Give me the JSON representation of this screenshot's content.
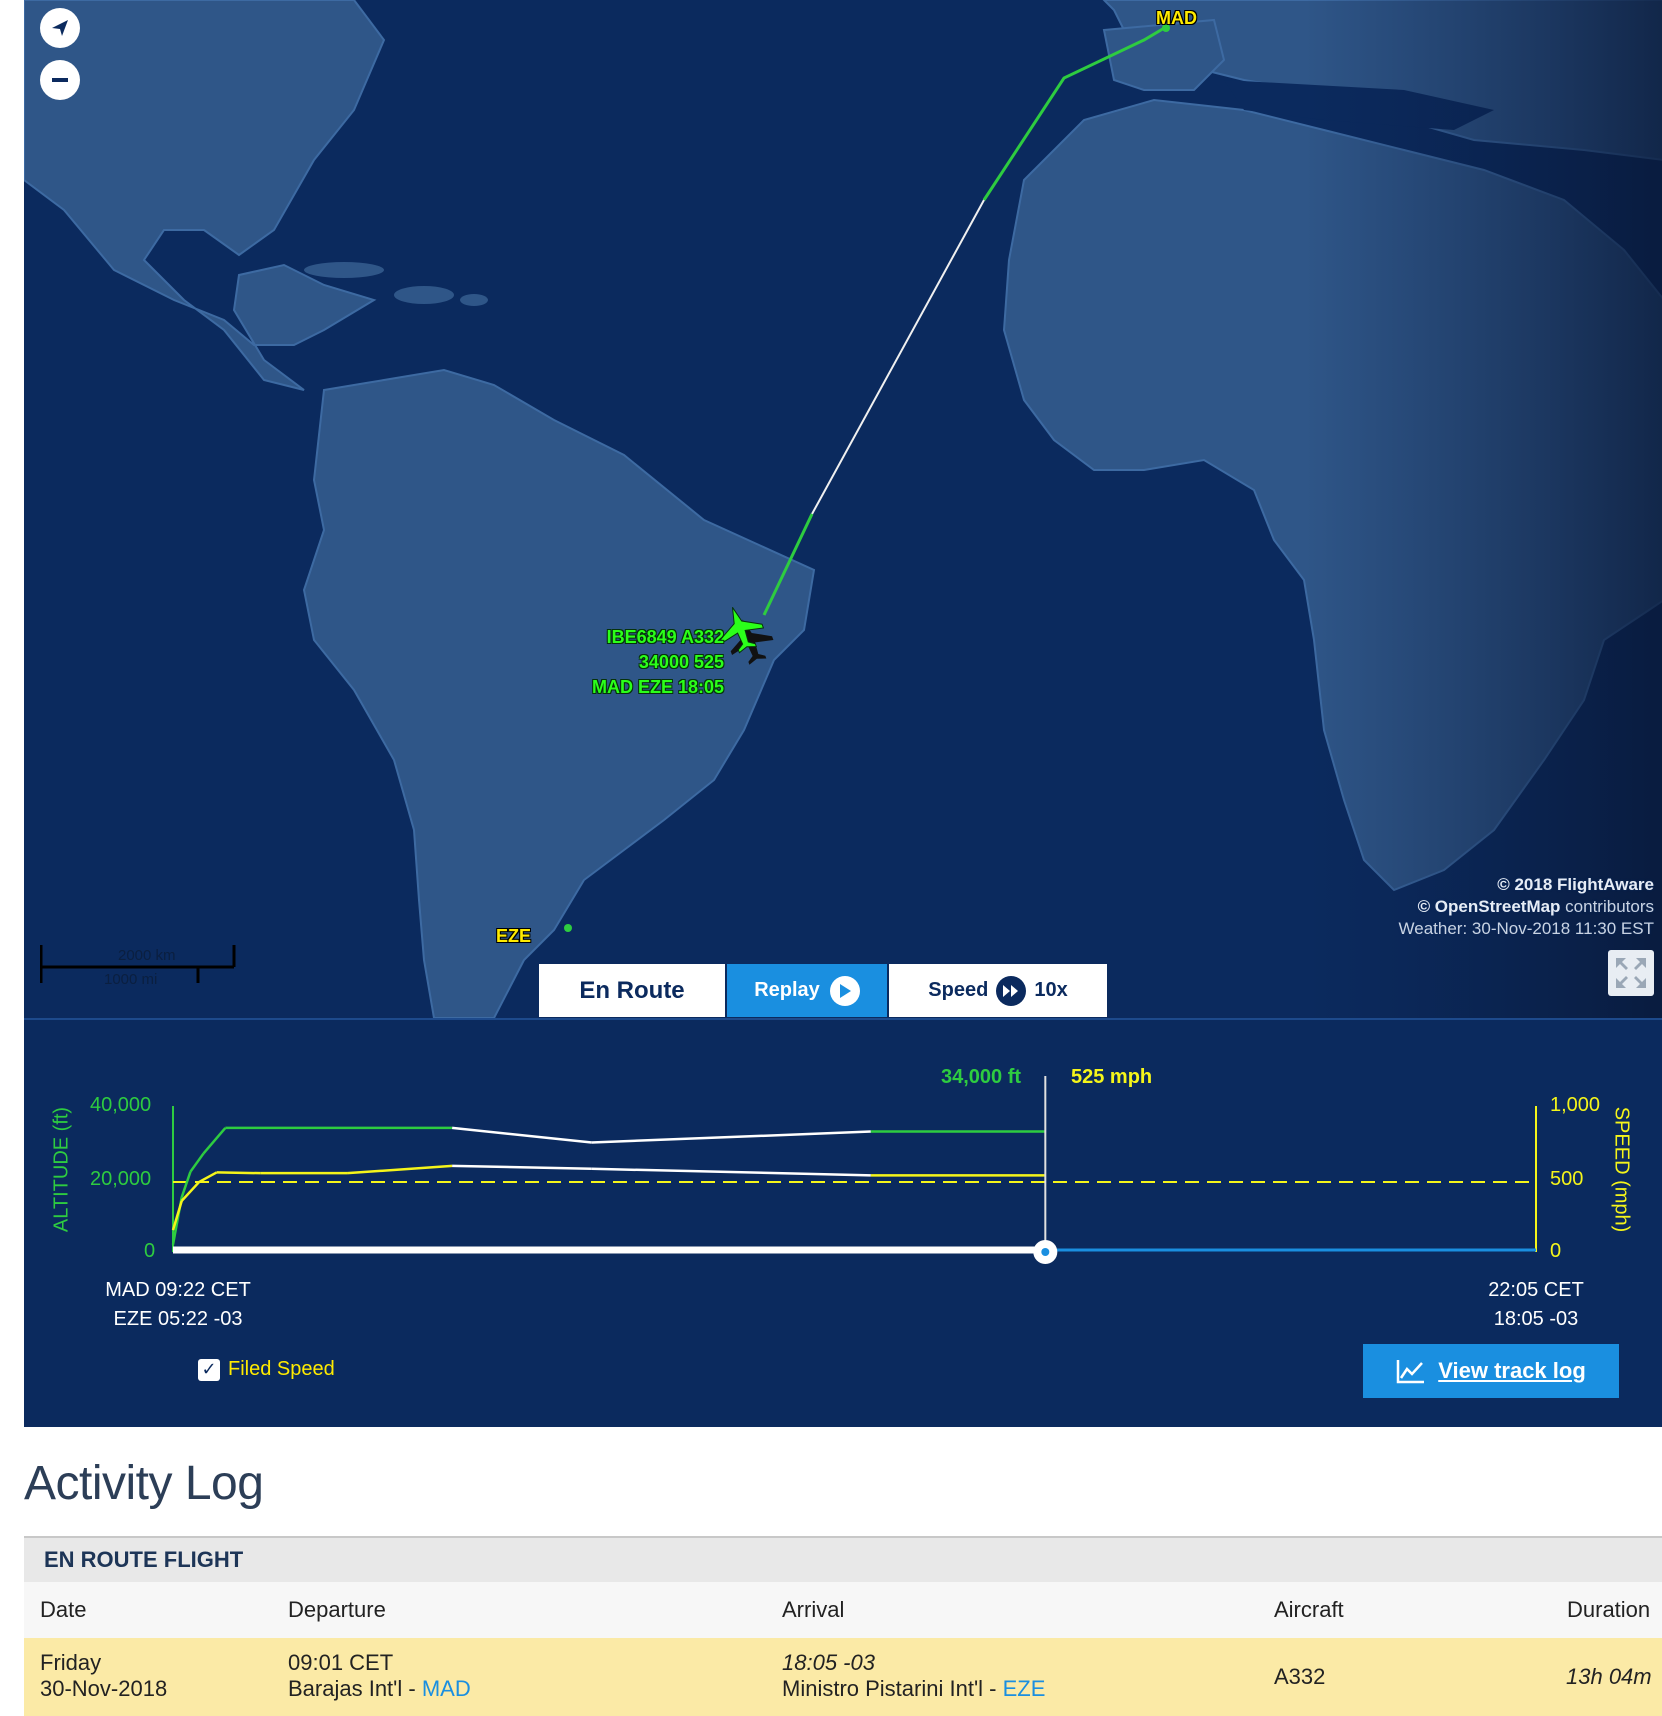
{
  "map": {
    "airports": {
      "origin": "MAD",
      "destination": "EZE"
    },
    "flight_tag": {
      "line1": "IBE6849 A332",
      "line2": "34000 525",
      "line3": "MAD EZE 18:05"
    },
    "attribution": {
      "line1": "© 2018 FlightAware",
      "line2_brand": "© OpenStreetMap",
      "line2_rest": " contributors",
      "line3": "Weather: 30-Nov-2018 11:30 EST"
    },
    "scale": {
      "km": "2000 km",
      "mi": "1000 mi"
    },
    "icons": [
      "compass-icon",
      "zoom-out-icon",
      "fullscreen-icon",
      "plane-icon"
    ]
  },
  "controls": {
    "status": "En Route",
    "replay": "Replay",
    "speed_label": "Speed",
    "speed_value": "10x"
  },
  "graph": {
    "current_altitude": "34,000 ft",
    "current_speed": "525 mph",
    "alt_axis": {
      "label": "ALTITUDE (ft)",
      "ticks": [
        "40,000",
        "20,000",
        "0"
      ]
    },
    "speed_axis": {
      "label": "SPEED (mph)",
      "ticks": [
        "1,000",
        "500",
        "0"
      ]
    },
    "start_time": {
      "line1": "MAD 09:22 CET",
      "line2": "EZE 05:22 -03"
    },
    "end_time": {
      "line1": "22:05 CET",
      "line2": "18:05 -03"
    },
    "filed_speed_label": "Filed Speed",
    "filed_speed_checked": true,
    "track_log_button": "View track log",
    "progress_fraction": 0.64,
    "colors": {
      "altitude": "#2ecc40",
      "speed": "#f5f51a",
      "gap": "#ffffff",
      "remaining": "#1a8fe0"
    }
  },
  "chart_data": {
    "type": "line",
    "series": [
      {
        "name": "ALTITUDE (ft)",
        "units": "ft",
        "x_fraction": [
          0.0,
          0.01,
          0.02,
          0.035,
          0.06,
          0.32,
          0.48,
          0.8,
          0.999
        ],
        "values": [
          2000,
          15000,
          22000,
          27000,
          34000,
          34000,
          30000,
          33000,
          33000
        ]
      },
      {
        "name": "SPEED (mph)",
        "units": "mph",
        "x_fraction": [
          0.0,
          0.01,
          0.03,
          0.05,
          0.1,
          0.2,
          0.32,
          0.48,
          0.8,
          0.999
        ],
        "values": [
          150,
          350,
          480,
          545,
          540,
          540,
          590,
          570,
          525,
          525
        ]
      }
    ],
    "filed_speed": 500,
    "ylim_altitude": [
      0,
      40000
    ],
    "ylim_speed": [
      0,
      1000
    ]
  },
  "activity": {
    "title": "Activity Log",
    "section": "EN ROUTE FLIGHT",
    "columns": [
      "Date",
      "Departure",
      "Arrival",
      "Aircraft",
      "Duration"
    ],
    "rows": [
      {
        "date_day": "Friday",
        "date": "30-Nov-2018",
        "dep_time": "09:01 CET",
        "dep_airport": "Barajas Int'l - ",
        "dep_code": "MAD",
        "arr_time": "18:05 -03",
        "arr_airport": "Ministro Pistarini Int'l - ",
        "arr_code": "EZE",
        "aircraft": "A332",
        "duration": "13h 04m"
      }
    ]
  }
}
